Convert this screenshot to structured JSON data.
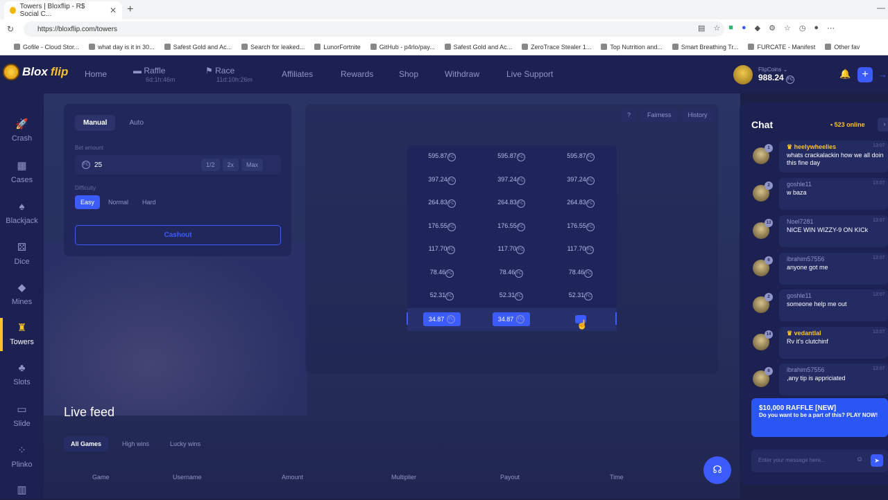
{
  "browser": {
    "tab_title": "Towers | Bloxflip - R$ Social C...",
    "url": "https://bloxflip.com/towers",
    "bookmarks": [
      "Gofile - Cloud Stor...",
      "what day is it in 30...",
      "Safest Gold and Ac...",
      "Search for leaked...",
      "LunorFortnite",
      "GitHub - p4rlo/pay...",
      "Safest Gold and Ac...",
      "ZeroTrace Stealer 1...",
      "Top Nutrition and...",
      "Smart Breathing Tr...",
      "FURCATE - Manifest",
      "Other fav"
    ]
  },
  "brand": {
    "blox": "Blox",
    "flip": "flip"
  },
  "nav": {
    "home": "Home",
    "raffle": "Raffle",
    "raffle_timer": "6d:1h:46m",
    "race": "Race",
    "race_timer": "11d:10h:26m",
    "affiliates": "Affiliates",
    "rewards": "Rewards",
    "shop": "Shop",
    "withdraw": "Withdraw",
    "support": "Live Support"
  },
  "wallet": {
    "label": "FlipCoins",
    "balance": "988.24"
  },
  "sidebar": {
    "items": [
      "Crash",
      "Cases",
      "Blackjack",
      "Dice",
      "Mines",
      "Towers",
      "Slots",
      "Slide",
      "Plinko"
    ]
  },
  "panel": {
    "tab_manual": "Manual",
    "tab_auto": "Auto",
    "bet_label": "Bet amount",
    "bet_value": "25",
    "half": "1/2",
    "double": "2x",
    "max": "Max",
    "diff_label": "Difficulty",
    "easy": "Easy",
    "normal": "Normal",
    "hard": "Hard",
    "cashout": "Cashout"
  },
  "game": {
    "help": "?",
    "fairness": "Fairness",
    "history": "History",
    "rows": [
      "595.87",
      "397.24",
      "264.83",
      "176.55",
      "117.70",
      "78.46",
      "52.31",
      "34.87"
    ]
  },
  "feed": {
    "title": "Live feed",
    "tabs": [
      "All Games",
      "High wins",
      "Lucky wins"
    ],
    "headers": [
      "Game",
      "Username",
      "Amount",
      "Multiplier",
      "Payout",
      "Time"
    ]
  },
  "chat": {
    "title": "Chat",
    "online": "• 523 online",
    "messages": [
      {
        "name": "heelywheelies",
        "time": "13:07",
        "text": "whats crackalackin how we all doin this fine day",
        "lvl": "1"
      },
      {
        "name": "goshle11",
        "time": "13:07",
        "text": "w baza",
        "lvl": "2"
      },
      {
        "name": "Noel7281",
        "time": "13:07",
        "text": "NICE WIN WIZZY-9 ON KICk",
        "lvl": "13"
      },
      {
        "name": "ibrahim57556",
        "time": "13:07",
        "text": "anyone got me",
        "lvl": "6"
      },
      {
        "name": "goshle11",
        "time": "13:07",
        "text": "someone help me out",
        "lvl": "2"
      },
      {
        "name": "vedantlal",
        "time": "13:07",
        "text": "Rv it's clutchinf",
        "lvl": "14"
      },
      {
        "name": "ibrahim57556",
        "time": "13:07",
        "text": ",any tip is appriciated",
        "lvl": "6"
      }
    ],
    "promo_title": "$10,000 RAFFLE [NEW]",
    "promo_text": "Do you want to be a part of this? PLAY NOW!",
    "input_placeholder": "Enter your message here..."
  }
}
